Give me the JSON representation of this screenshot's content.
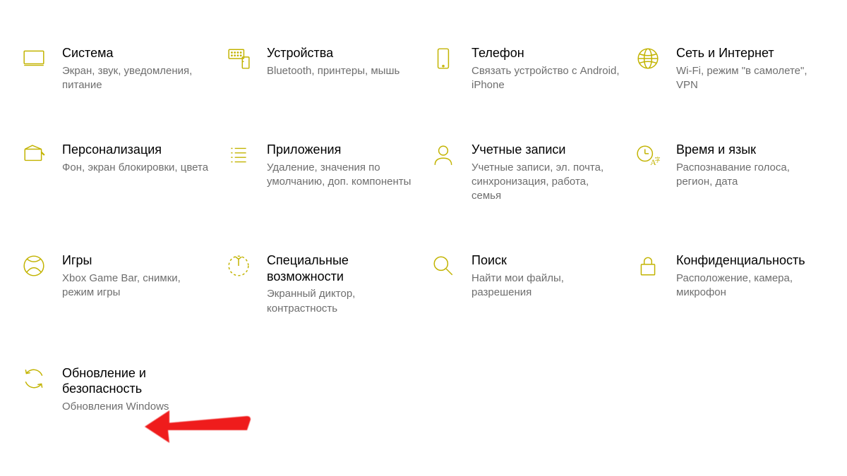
{
  "accent_color": "#c2b300",
  "categories": [
    {
      "id": "system",
      "icon": "monitor-icon",
      "title": "Система",
      "sub": "Экран, звук, уведомления, питание"
    },
    {
      "id": "devices",
      "icon": "devices-icon",
      "title": "Устройства",
      "sub": "Bluetooth, принтеры, мышь"
    },
    {
      "id": "phone",
      "icon": "phone-icon",
      "title": "Телефон",
      "sub": "Связать устройство с Android, iPhone"
    },
    {
      "id": "network",
      "icon": "globe-icon",
      "title": "Сеть и Интернет",
      "sub": "Wi-Fi, режим \"в самолете\", VPN"
    },
    {
      "id": "personalization",
      "icon": "paint-icon",
      "title": "Персонализация",
      "sub": "Фон, экран блокировки, цвета"
    },
    {
      "id": "apps",
      "icon": "apps-icon",
      "title": "Приложения",
      "sub": "Удаление, значения по умолчанию, доп. компоненты"
    },
    {
      "id": "accounts",
      "icon": "person-icon",
      "title": "Учетные записи",
      "sub": "Учетные записи, эл. почта, синхронизация, работа, семья"
    },
    {
      "id": "time-lang",
      "icon": "time-lang-icon",
      "title": "Время и язык",
      "sub": "Распознавание голоса, регион, дата"
    },
    {
      "id": "gaming",
      "icon": "xbox-icon",
      "title": "Игры",
      "sub": "Xbox Game Bar, снимки, режим игры"
    },
    {
      "id": "ease-of-access",
      "icon": "ease-icon",
      "title": "Специальные возможности",
      "sub": "Экранный диктор, контрастность"
    },
    {
      "id": "search",
      "icon": "search-icon",
      "title": "Поиск",
      "sub": "Найти мои файлы, разрешения"
    },
    {
      "id": "privacy",
      "icon": "lock-icon",
      "title": "Конфиденциальность",
      "sub": "Расположение, камера, микрофон"
    },
    {
      "id": "update-security",
      "icon": "sync-icon",
      "title": "Обновление и безопасность",
      "sub": "Обновления Windows"
    }
  ],
  "annotation": {
    "arrow_points_to": "update-security",
    "color": "#ef1c1c"
  }
}
